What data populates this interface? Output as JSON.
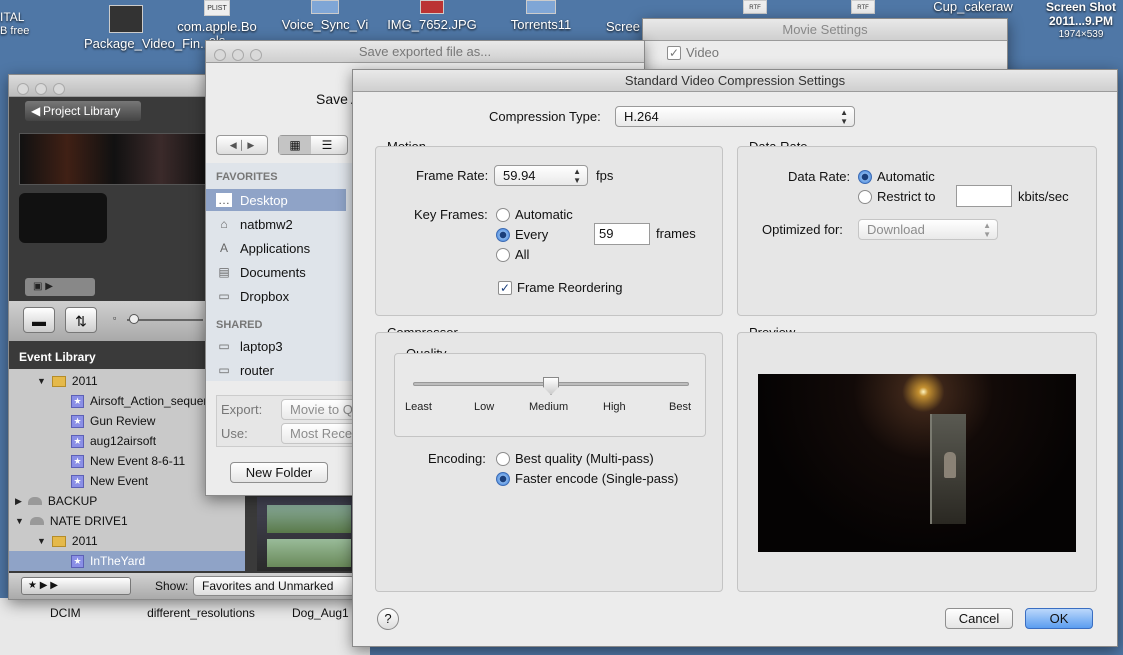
{
  "desktop": {
    "icons": [
      {
        "label": "Package_Video_Fin....mov",
        "x": 0
      },
      {
        "label": "com.apple.Bo ols",
        "x": 0
      },
      {
        "label": "Voice_Sync_Vi",
        "x": 0
      },
      {
        "label": "IMG_7652.JPG",
        "x": 0
      },
      {
        "label": "Torrents11",
        "x": 0
      },
      {
        "label": "Scree",
        "x": 0
      },
      {
        "label": "Cup_cakeraw",
        "x": 0
      },
      {
        "label": "Screen Shot 2011...9.PM",
        "x": 0
      }
    ],
    "left_edge_label": "ITAL",
    "left_edge_sub": "B free",
    "file_badges": [
      "PLIST",
      "RTF",
      "RTF"
    ],
    "corner_label": "Screen Shot 2011...9.PM",
    "corner_sub": "1974×539",
    "bottom_icons": [
      "DCIM",
      "different_resolutions",
      "Dog_Aug1"
    ]
  },
  "movie_settings": {
    "title": "Movie Settings",
    "video_label": "Video"
  },
  "save_dialog": {
    "title": "Save exported file as...",
    "save_as_label": "Save A",
    "favorites_header": "FAVORITES",
    "favorites": [
      "Desktop",
      "natbmw2",
      "Applications",
      "Documents",
      "Dropbox"
    ],
    "shared_header": "SHARED",
    "shared": [
      "laptop3",
      "router"
    ],
    "export_label": "Export:",
    "export_value": "Movie to Q",
    "use_label": "Use:",
    "use_value": "Most Rece",
    "new_folder": "New Folder"
  },
  "imovie": {
    "project_library": "Project Library",
    "event_library": "Event Library",
    "tree": [
      {
        "label": "2011",
        "kind": "year"
      },
      {
        "label": "Airsoft_Action_sequer",
        "kind": "event"
      },
      {
        "label": "Gun Review",
        "kind": "event"
      },
      {
        "label": "aug12airsoft",
        "kind": "event"
      },
      {
        "label": "New Event 8-6-11",
        "kind": "event"
      },
      {
        "label": "New Event",
        "kind": "event"
      },
      {
        "label": "BACKUP",
        "kind": "drive"
      },
      {
        "label": "NATE DRIVE1",
        "kind": "drive"
      },
      {
        "label": "2011",
        "kind": "year"
      },
      {
        "label": "InTheYard",
        "kind": "event"
      }
    ],
    "show_label": "Show:",
    "show_value": "Favorites and Unmarked"
  },
  "compression": {
    "title": "Standard Video Compression Settings",
    "type_label": "Compression Type:",
    "type_value": "H.264",
    "motion": {
      "title": "Motion",
      "frame_rate_label": "Frame Rate:",
      "frame_rate_value": "59.94",
      "fps": "fps",
      "key_frames_label": "Key Frames:",
      "kf_automatic": "Automatic",
      "kf_every": "Every",
      "kf_every_value": "59",
      "kf_frames": "frames",
      "kf_all": "All",
      "frame_reordering": "Frame Reordering"
    },
    "data_rate": {
      "title": "Data Rate",
      "label": "Data Rate:",
      "automatic": "Automatic",
      "restrict": "Restrict to",
      "restrict_value": "",
      "unit": "kbits/sec",
      "optimized_label": "Optimized for:",
      "optimized_value": "Download"
    },
    "compressor": {
      "title": "Compressor",
      "quality_title": "Quality",
      "ticks": [
        "Least",
        "Low",
        "Medium",
        "High",
        "Best"
      ],
      "quality_level": 0.5,
      "encoding_label": "Encoding:",
      "best": "Best quality (Multi-pass)",
      "faster": "Faster encode (Single-pass)"
    },
    "preview_title": "Preview",
    "help": "?",
    "cancel": "Cancel",
    "ok": "OK"
  },
  "colors": {
    "accent": "#5b9df0",
    "selection": "#8fa3c7",
    "desktop": "#4f77a6"
  }
}
